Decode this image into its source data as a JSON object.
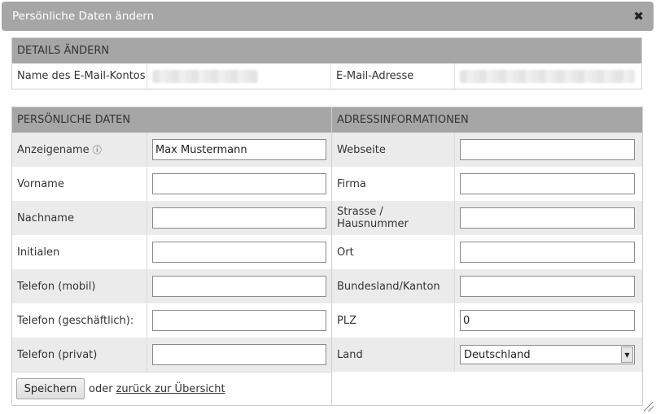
{
  "dialog": {
    "title": "Persönliche Daten ändern",
    "close_icon": "close-icon",
    "close_glyph": "✖"
  },
  "details": {
    "header": "DETAILS ÄNDERN",
    "account_label": "Name des E-Mail-Kontos",
    "email_label": "E-Mail-Adresse"
  },
  "personal": {
    "header": "PERSÖNLICHE DATEN",
    "fields": [
      {
        "label": "Anzeigename",
        "value": "Max Mustermann",
        "info_icon": "info-icon",
        "info_glyph": "ⓘ"
      },
      {
        "label": "Vorname",
        "value": ""
      },
      {
        "label": "Nachname",
        "value": ""
      },
      {
        "label": "Initialen",
        "value": ""
      },
      {
        "label": "Telefon (mobil)",
        "value": ""
      },
      {
        "label": "Telefon (geschäftlich):",
        "value": ""
      },
      {
        "label": "Telefon (privat)",
        "value": ""
      }
    ]
  },
  "address": {
    "header": "ADRESSINFORMATIONEN",
    "fields": [
      {
        "label": "Webseite",
        "value": ""
      },
      {
        "label": "Firma",
        "value": ""
      },
      {
        "label": "Strasse / Hausnummer",
        "value": ""
      },
      {
        "label": "Ort",
        "value": ""
      },
      {
        "label": "Bundesland/Kanton",
        "value": ""
      },
      {
        "label": "PLZ",
        "value": "0"
      },
      {
        "label": "Land",
        "value": "Deutschland",
        "arrow_glyph": "▼"
      }
    ]
  },
  "actions": {
    "save_label": "Speichern",
    "or_text": "oder",
    "back_link": "zurück zur Übersicht"
  },
  "colors": {
    "header_bg": "#a6a6a6",
    "alt_row_bg": "#ebebeb",
    "title_text": "#ffffff"
  }
}
